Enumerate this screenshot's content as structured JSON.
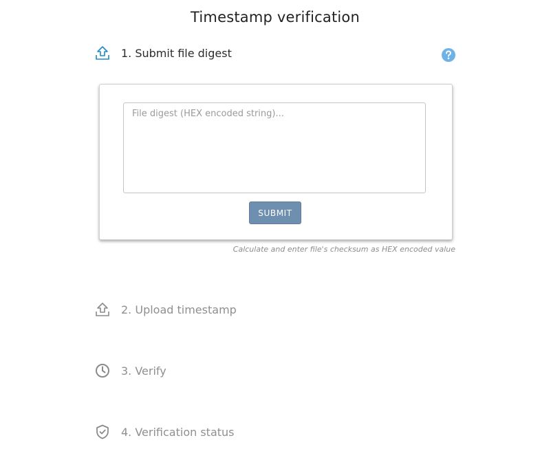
{
  "page": {
    "title": "Timestamp verification"
  },
  "steps": [
    {
      "label": "1. Submit file digest",
      "icon": "upload-icon",
      "state": "active"
    },
    {
      "label": "2. Upload timestamp",
      "icon": "upload-icon",
      "state": "inactive"
    },
    {
      "label": "3. Verify",
      "icon": "clock-icon",
      "state": "inactive"
    },
    {
      "label": "4. Verification status",
      "icon": "shield-check-icon",
      "state": "inactive"
    }
  ],
  "help": {
    "icon": "question-circle-icon"
  },
  "digest_form": {
    "input_value": "",
    "placeholder": "File digest (HEX encoded string)...",
    "submit_label": "SUBMIT",
    "hint": "Calculate and enter file's checksum as HEX encoded value"
  },
  "colors": {
    "active_icon": "#1e88c8",
    "inactive_icon": "#8a8a8a",
    "help_icon": "#6fb3e6",
    "submit_button": "#6e8fb0"
  }
}
